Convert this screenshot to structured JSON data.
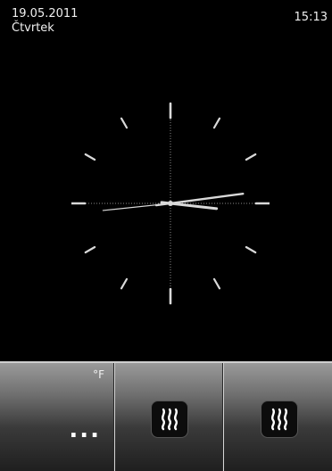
{
  "status": {
    "date": "19.05.2011",
    "day": "Čtvrtek",
    "time": "15:13"
  },
  "clock": {
    "hour": 15,
    "minute": 13,
    "second": 44
  },
  "bottom_bar": {
    "temperature_unit": "°F",
    "temperature_value": "...",
    "tiles": [
      {
        "icon": "heating-icon"
      },
      {
        "icon": "heating-icon"
      }
    ]
  },
  "colors": {
    "background": "#000000",
    "clock_marks": "#d9d9d9"
  }
}
